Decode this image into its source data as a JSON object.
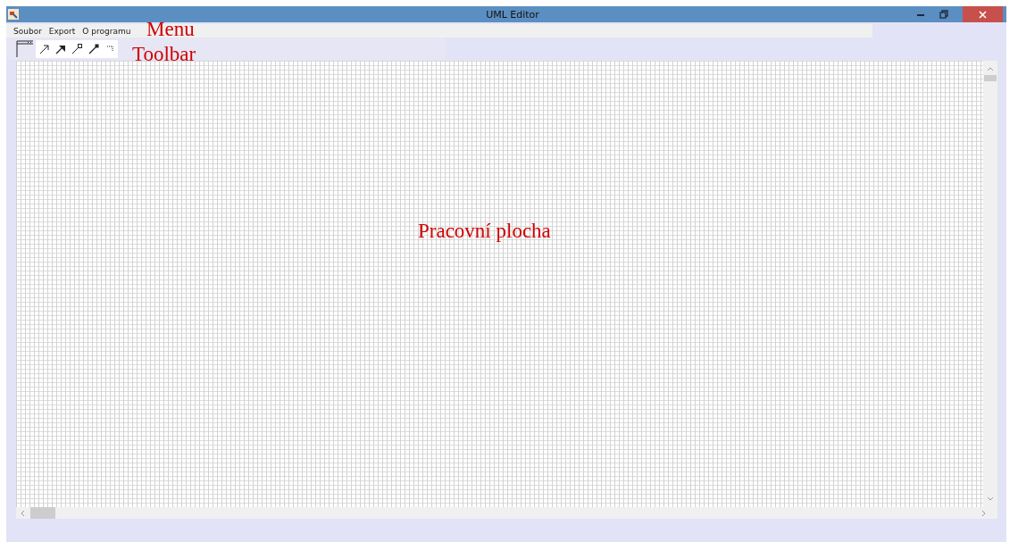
{
  "window": {
    "title": "UML Editor"
  },
  "menu": [
    "Soubor",
    "Export",
    "O programu"
  ],
  "annotations": [
    "Menu",
    "Toolbar",
    "Pracovní plocha"
  ]
}
